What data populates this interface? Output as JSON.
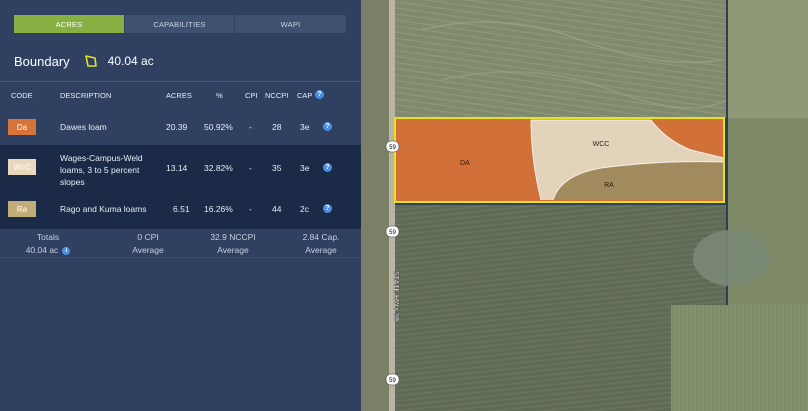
{
  "tabs": [
    {
      "label": "ACRES",
      "active": true
    },
    {
      "label": "CAPABILITIES",
      "active": false
    },
    {
      "label": "WAPI",
      "active": false
    }
  ],
  "boundary": {
    "title": "Boundary",
    "acres": "40.04 ac",
    "icon": "polygon-icon"
  },
  "table": {
    "headers": {
      "code": "CODE",
      "description": "DESCRIPTION",
      "acres": "ACRES",
      "percent": "%",
      "cpi": "CPI",
      "nccpi": "NCCPI",
      "cap": "CAP"
    },
    "rows": [
      {
        "code": "Da",
        "color": "#d8743a",
        "description": "Dawes loam",
        "acres": "20.39",
        "percent": "50.92%",
        "cpi": "-",
        "nccpi": "28",
        "cap": "3e"
      },
      {
        "code": "WcC",
        "color": "#ead8bd",
        "description": "Wages-Campus-Weld loams, 3 to 5 percent slopes",
        "acres": "13.14",
        "percent": "32.82%",
        "cpi": "-",
        "nccpi": "35",
        "cap": "3e"
      },
      {
        "code": "Ra",
        "color": "#c2ad78",
        "description": "Rago and Kuma loams",
        "acres": "6.51",
        "percent": "16.26%",
        "cpi": "-",
        "nccpi": "44",
        "cap": "2c"
      }
    ],
    "totals": {
      "label": "Totals",
      "acres": "40.04 ac",
      "cpi_value": "0 CPI",
      "cpi_sub": "Average",
      "nccpi_value": "32.9 NCCPI",
      "nccpi_sub": "Average",
      "cap_value": "2.84 Cap.",
      "cap_sub": "Average"
    }
  },
  "map": {
    "labels": {
      "da": "DA",
      "wcc": "WCC",
      "ra": "RA"
    },
    "road_label": "STATE HWY 59",
    "shields": [
      "59",
      "59",
      "59"
    ],
    "colors": {
      "da": "#d2703a",
      "wcc": "#e3d3ba",
      "ra": "#a08a5e",
      "boundary": "#e6e21e"
    }
  }
}
